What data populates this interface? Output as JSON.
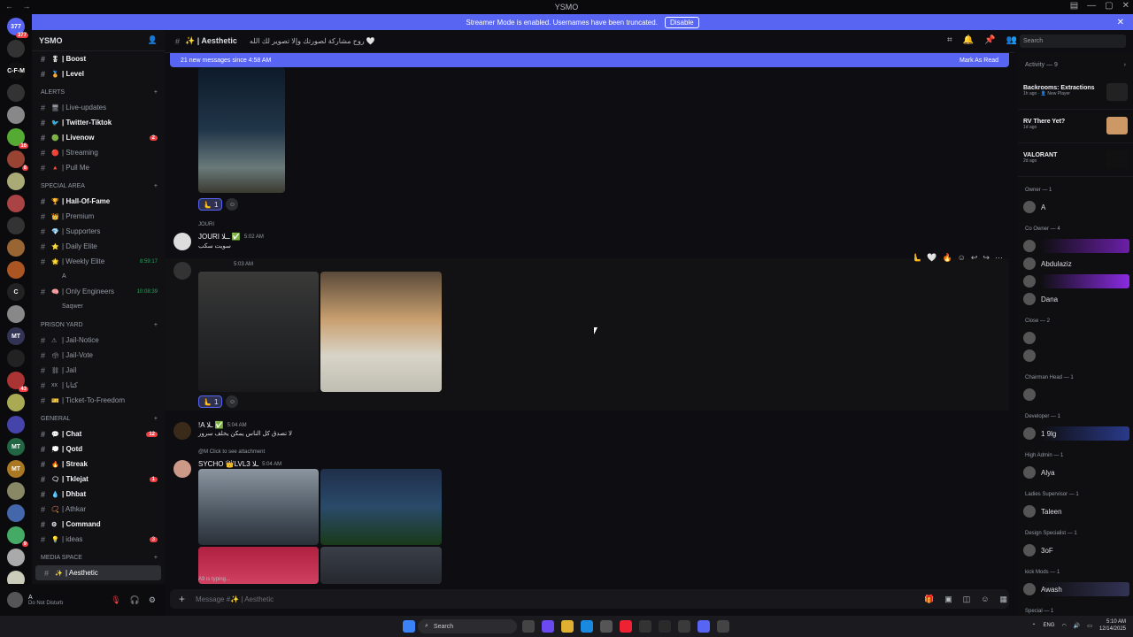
{
  "window": {
    "title": "YSMO"
  },
  "banner": {
    "text": "Streamer Mode is enabled. Usernames have been truncated.",
    "disable_label": "Disable"
  },
  "servers": [
    {
      "label": "377",
      "badge": "377",
      "color": "#5865f2"
    },
    {
      "label": "",
      "badge": "",
      "color": "#333"
    },
    {
      "label": "C-F-M",
      "badge": "",
      "color": "#111"
    },
    {
      "label": "",
      "badge": "",
      "color": "#333"
    },
    {
      "label": "",
      "badge": "",
      "color": "#888"
    },
    {
      "label": "",
      "badge": "16",
      "color": "#5a3"
    },
    {
      "label": "",
      "badge": "8",
      "color": "#943"
    },
    {
      "label": "",
      "badge": "",
      "color": "#aa7"
    },
    {
      "label": "",
      "badge": "",
      "color": "#a44"
    },
    {
      "label": "",
      "badge": "",
      "color": "#333"
    },
    {
      "label": "",
      "badge": "",
      "color": "#963"
    },
    {
      "label": "",
      "badge": "",
      "color": "#a52"
    },
    {
      "label": "C",
      "badge": "",
      "color": "#222"
    },
    {
      "label": "",
      "badge": "",
      "color": "#888"
    },
    {
      "label": "MT",
      "badge": "",
      "color": "#335"
    },
    {
      "label": "",
      "badge": "",
      "color": "#222"
    },
    {
      "label": "",
      "badge": "43",
      "color": "#a33"
    },
    {
      "label": "",
      "badge": "",
      "color": "#aa5"
    },
    {
      "label": "",
      "badge": "",
      "color": "#44a"
    },
    {
      "label": "MT",
      "badge": "",
      "color": "#264"
    },
    {
      "label": "MT",
      "badge": "",
      "color": "#a72"
    },
    {
      "label": "",
      "badge": "",
      "color": "#886"
    },
    {
      "label": "",
      "badge": "",
      "color": "#46a"
    },
    {
      "label": "",
      "badge": "9",
      "color": "#4a6"
    },
    {
      "label": "",
      "badge": "",
      "color": "#aaa"
    },
    {
      "label": "",
      "badge": "",
      "color": "#ccb"
    },
    {
      "label": "",
      "badge": "",
      "color": "#666"
    }
  ],
  "guild": {
    "name": "YSMO"
  },
  "channels": [
    {
      "type": "ch",
      "emoji": "🎖",
      "name": "| Boost",
      "bold": true
    },
    {
      "type": "ch",
      "emoji": "🏅",
      "name": "| Level",
      "bold": true
    },
    {
      "type": "cat",
      "name": "ALERTS"
    },
    {
      "type": "ch",
      "emoji": "🖥",
      "name": "| Live-updates"
    },
    {
      "type": "ch",
      "emoji": "🐦",
      "name": "| Twitter-Tiktok",
      "bold": true
    },
    {
      "type": "ch",
      "emoji": "🟢",
      "name": "| Livenow",
      "bold": true,
      "count": "2"
    },
    {
      "type": "ch",
      "emoji": "🔴",
      "name": "| Streaming"
    },
    {
      "type": "ch",
      "emoji": "🔺",
      "name": "| Pull Me"
    },
    {
      "type": "cat",
      "name": "SPECIAL AREA"
    },
    {
      "type": "ch",
      "emoji": "🏆",
      "name": "| Hall-Of-Fame",
      "bold": true
    },
    {
      "type": "ch",
      "emoji": "👑",
      "name": "| Premium"
    },
    {
      "type": "ch",
      "emoji": "💎",
      "name": "| Supporters"
    },
    {
      "type": "ch",
      "emoji": "⭐",
      "name": "| Daily Elite"
    },
    {
      "type": "ch",
      "emoji": "🌟",
      "name": "| Weekly Elite",
      "time": "8:59:17"
    },
    {
      "type": "sub",
      "name": "A"
    },
    {
      "type": "ch",
      "emoji": "🧠",
      "name": "| Only Engineers",
      "time": "10:08:39"
    },
    {
      "type": "sub",
      "name": "Saqwer"
    },
    {
      "type": "cat",
      "name": "PRISON YARD"
    },
    {
      "type": "ch",
      "emoji": "⚠",
      "name": "| Jail-Notice"
    },
    {
      "type": "ch",
      "emoji": "🗳",
      "name": "| Jail-Vote"
    },
    {
      "type": "ch",
      "emoji": "⛓",
      "name": "| Jail"
    },
    {
      "type": "ch",
      "emoji": "xx",
      "name": "| كتابا"
    },
    {
      "type": "ch",
      "emoji": "🎫",
      "name": "| Ticket-To-Freedom"
    },
    {
      "type": "cat",
      "name": "GENERAL"
    },
    {
      "type": "ch",
      "emoji": "💬",
      "name": "| Chat",
      "bold": true,
      "count": "12"
    },
    {
      "type": "ch",
      "emoji": "💭",
      "name": "| Qotd",
      "bold": true
    },
    {
      "type": "ch",
      "emoji": "🔥",
      "name": "| Streak",
      "bold": true
    },
    {
      "type": "ch",
      "emoji": "🗨",
      "name": "| Tklejat",
      "bold": true,
      "count": "1"
    },
    {
      "type": "ch",
      "emoji": "💧",
      "name": "| Dhbat",
      "bold": true
    },
    {
      "type": "ch",
      "emoji": "📿",
      "name": "| Athkar"
    },
    {
      "type": "ch",
      "emoji": "⚙",
      "name": "| Command",
      "bold": true
    },
    {
      "type": "ch",
      "emoji": "💡",
      "name": "| ideas",
      "count": "3"
    },
    {
      "type": "cat",
      "name": "MEDIA SPACE"
    },
    {
      "type": "ch",
      "emoji": "✨",
      "name": "| Aesthetic",
      "active": true
    }
  ],
  "user": {
    "name": "A",
    "status": "Do Not Disturb"
  },
  "channel_header": {
    "name": "✨ | Aesthetic",
    "topic": "روح مشاركة لصورتك وإلا تصوير لك الله 🤍"
  },
  "search": {
    "placeholder": "Search"
  },
  "new_messages": {
    "text": "21 new messages since 4:58 AM",
    "action": "Mark As Read"
  },
  "messages": {
    "r1": "1",
    "r2": "1",
    "m1_reply": "JOURI",
    "m1_user": "JOURI ــلا ✅",
    "m1_time": "5:02 AM",
    "m1_text": "سويت سكب",
    "m2_time": "5:03 AM",
    "m3_user": "!A ـلا ✅",
    "m3_time": "5:04 AM",
    "m3_text": "لا تصدق كل الناس يمكن يخلف سرور",
    "m4_reply": "@M Click to see attachment",
    "m4_user": "SYCHO 👑LVL3 ـلا",
    "m4_time": "5:04 AM"
  },
  "typing": "A9 is typing...",
  "input": {
    "placeholder": "Message #✨ | Aesthetic"
  },
  "activity": {
    "title": "Activity — 9",
    "items": [
      {
        "title": "Backrooms: Extractions",
        "sub": "1h ago · 👤 New Player",
        "color": "#222"
      },
      {
        "title": "RV There Yet?",
        "sub": "1d ago",
        "color": "#c96"
      },
      {
        "title": "VALORANT",
        "sub": "2d ago",
        "color": "#111"
      }
    ]
  },
  "roles": [
    {
      "name": "Owner — 1",
      "members": [
        {
          "name": "A",
          "grad": ""
        }
      ]
    },
    {
      "name": "Co Owner — 4",
      "members": [
        {
          "name": "",
          "grad": "#6b1fa8"
        },
        {
          "name": "Abdulaziz",
          "grad": ""
        },
        {
          "name": "",
          "grad": "#8a2be2"
        },
        {
          "name": "Dana",
          "grad": ""
        }
      ]
    },
    {
      "name": "Close — 2",
      "members": [
        {
          "name": "",
          "grad": ""
        },
        {
          "name": "",
          "grad": ""
        }
      ]
    },
    {
      "name": "Chairman Head — 1",
      "members": [
        {
          "name": "",
          "grad": ""
        }
      ]
    },
    {
      "name": "Developer — 1",
      "members": [
        {
          "name": "1 9lg",
          "grad": "#2a3a8a"
        }
      ]
    },
    {
      "name": "High Admin — 1",
      "members": [
        {
          "name": "Alya",
          "grad": ""
        }
      ]
    },
    {
      "name": "Ladies Supervisor — 1",
      "members": [
        {
          "name": "Taleen",
          "grad": ""
        }
      ]
    },
    {
      "name": "Design Specialist — 1",
      "members": [
        {
          "name": "3oF",
          "grad": ""
        }
      ]
    },
    {
      "name": "kick Mods — 1",
      "members": [
        {
          "name": "Awash",
          "grad": "#335"
        }
      ]
    },
    {
      "name": "Special — 1",
      "members": []
    }
  ],
  "taskbar": {
    "search": "Search",
    "lang": "ENG",
    "time": "5:10 AM",
    "date": "12/14/2025"
  }
}
